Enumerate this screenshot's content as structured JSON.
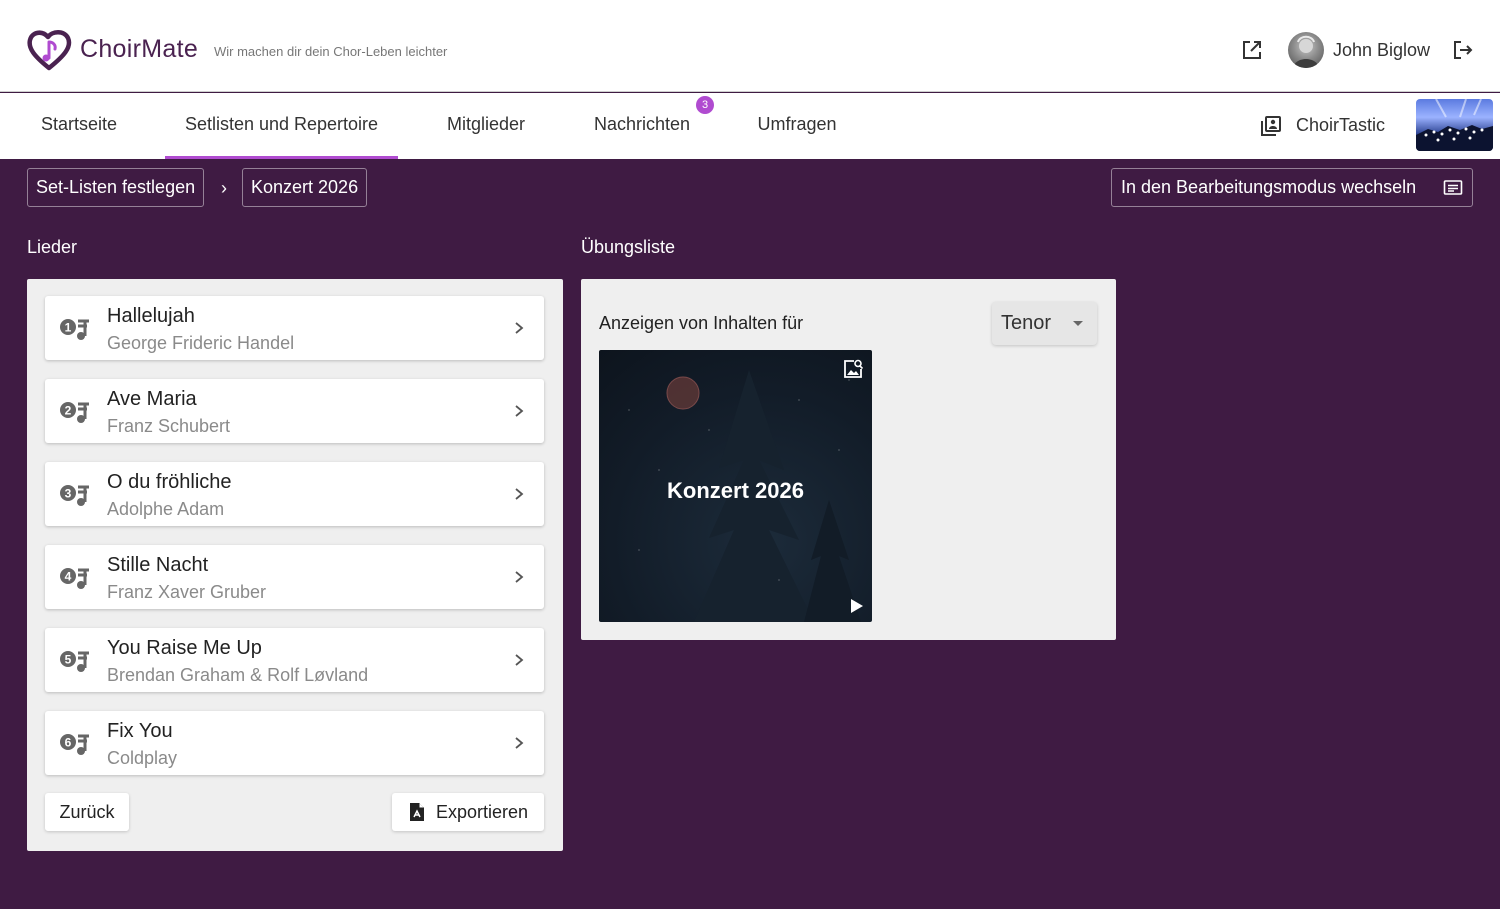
{
  "header": {
    "app_name": "ChoirMate",
    "tagline": "Wir machen dir dein Chor-Leben leichter",
    "user_name": "John Biglow"
  },
  "nav": {
    "tabs": [
      {
        "label": "Startseite"
      },
      {
        "label": "Setlisten und Repertoire"
      },
      {
        "label": "Mitglieder"
      },
      {
        "label": "Nachrichten"
      },
      {
        "label": "Umfragen"
      }
    ],
    "messages_badge": "3",
    "choir_name": "ChoirTastic"
  },
  "breadcrumb": {
    "items": [
      "Set-Listen festlegen",
      "Konzert 2026"
    ],
    "separator": "›"
  },
  "mode_button_label": "In den Bearbeitungsmodus wechseln",
  "songs": {
    "title": "Lieder",
    "items": [
      {
        "number": "1",
        "title": "Hallelujah",
        "artist": "George Frideric Handel"
      },
      {
        "number": "2",
        "title": "Ave Maria",
        "artist": "Franz Schubert"
      },
      {
        "number": "3",
        "title": "O du fröhliche",
        "artist": "Adolphe Adam"
      },
      {
        "number": "4",
        "title": "Stille Nacht",
        "artist": "Franz Xaver Gruber"
      },
      {
        "number": "5",
        "title": "You Raise Me Up",
        "artist": "Brendan Graham & Rolf Løvland"
      },
      {
        "number": "6",
        "title": "Fix You",
        "artist": "Coldplay"
      }
    ],
    "back_label": "Zurück",
    "export_label": "Exportieren"
  },
  "practice": {
    "title": "Übungsliste",
    "show_label": "Anzeigen von Inhalten für",
    "voice_selected": "Tenor",
    "media_title": "Konzert 2026"
  },
  "colors": {
    "background": "#3f1b43",
    "accent": "#b04bd0",
    "brand": "#4a2250"
  }
}
